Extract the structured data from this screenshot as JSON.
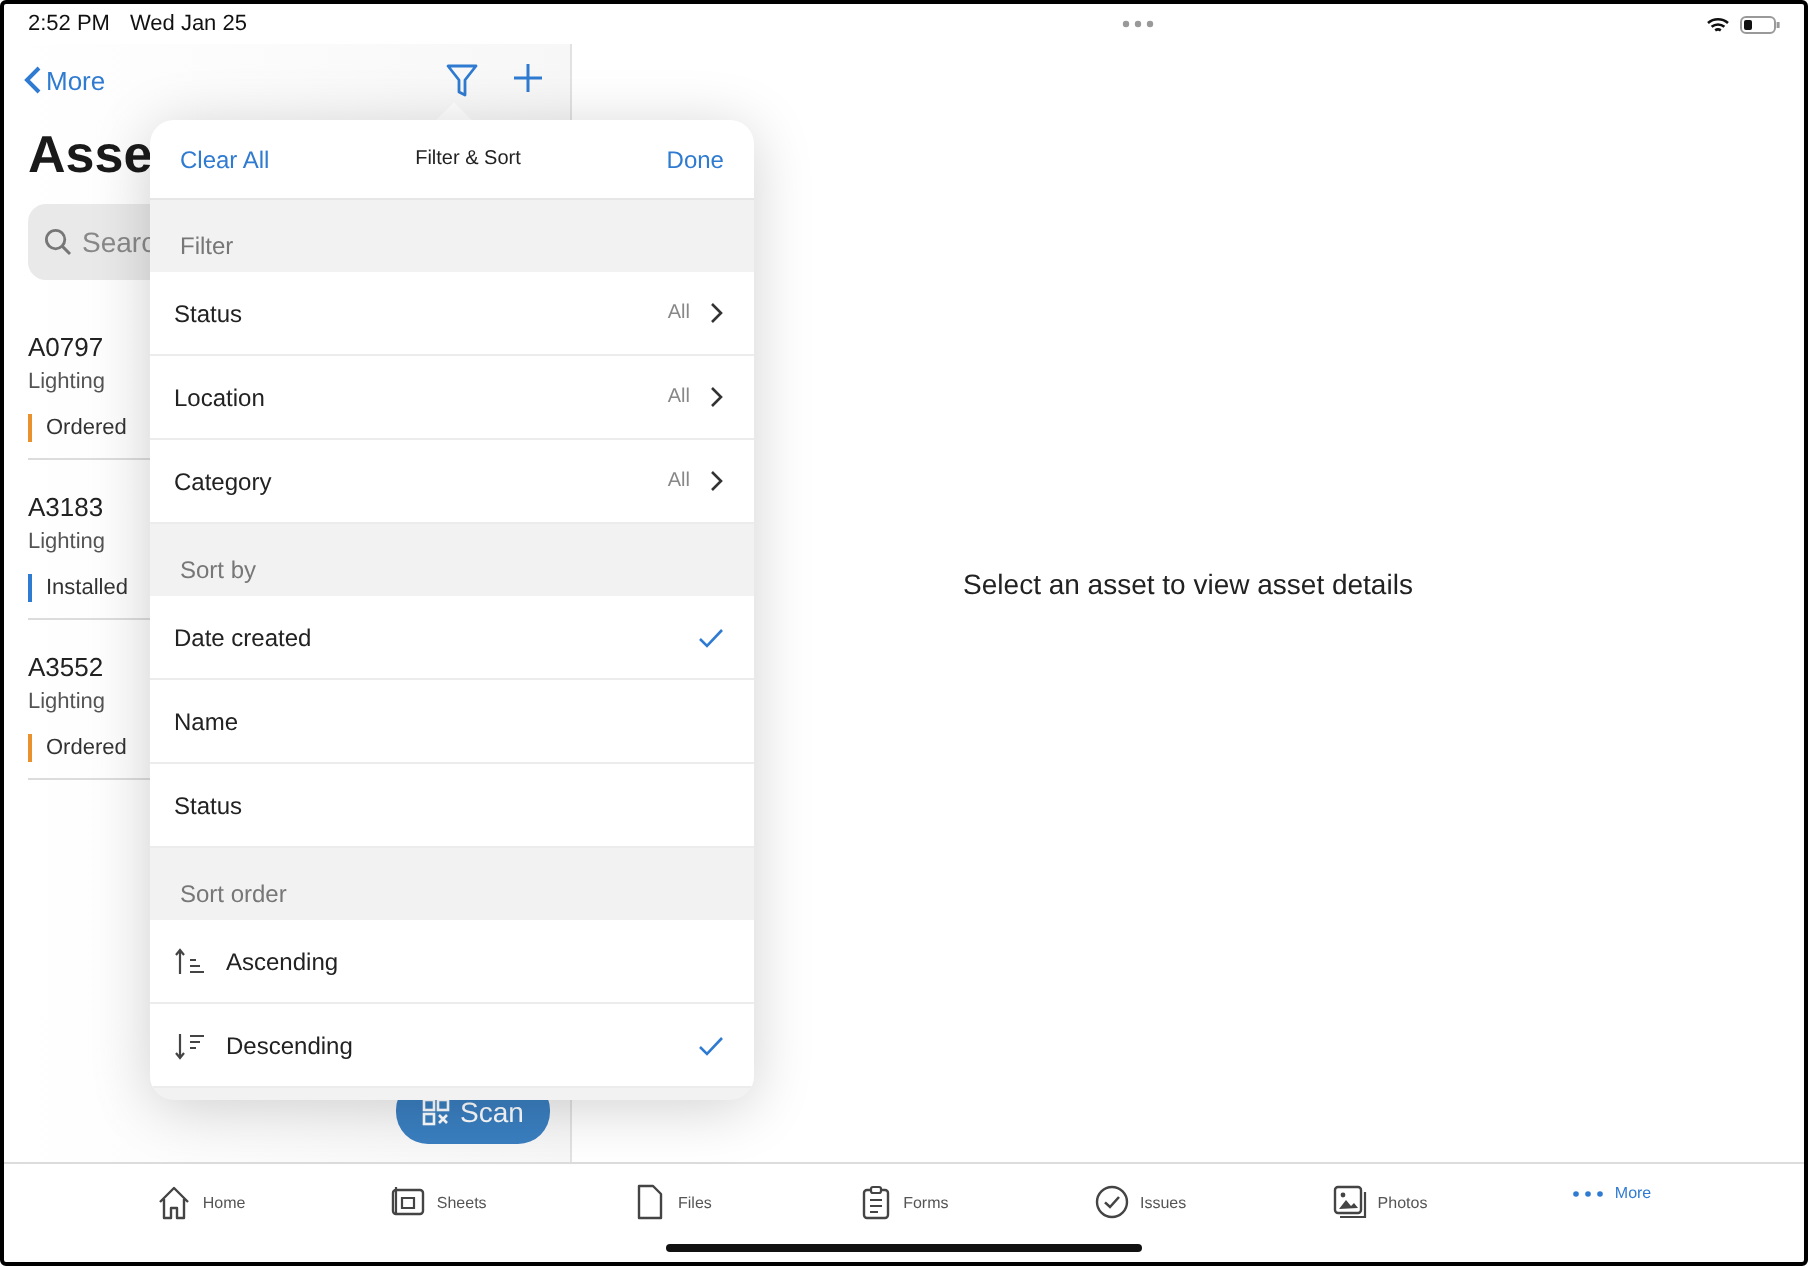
{
  "status_bar": {
    "time": "2:52 PM",
    "date": "Wed Jan 25"
  },
  "nav": {
    "back": "More",
    "title": "Asse"
  },
  "search": {
    "placeholder": "Searc"
  },
  "assets": [
    {
      "id": "A0797",
      "category": "Lighting",
      "status": "Ordered",
      "color": "#e8912d"
    },
    {
      "id": "A3183",
      "category": "Lighting",
      "status": "Installed",
      "color": "#2f7bd1"
    },
    {
      "id": "A3552",
      "category": "Lighting",
      "status": "Ordered",
      "color": "#e8912d"
    }
  ],
  "scan_button": "Scan",
  "detail_message": "Select an asset to view asset details",
  "popover": {
    "clear": "Clear All",
    "title": "Filter & Sort",
    "done": "Done",
    "sections": [
      {
        "title": "Filter",
        "items": [
          {
            "kind": "filter",
            "label": "Status",
            "value": "All"
          },
          {
            "kind": "filter",
            "label": "Location",
            "value": "All"
          },
          {
            "kind": "filter",
            "label": "Category",
            "value": "All"
          }
        ]
      },
      {
        "title": "Sort by",
        "items": [
          {
            "kind": "choice",
            "label": "Date created",
            "selected": true
          },
          {
            "kind": "choice",
            "label": "Name",
            "selected": false
          },
          {
            "kind": "choice",
            "label": "Status",
            "selected": false
          }
        ]
      },
      {
        "title": "Sort order",
        "items": [
          {
            "kind": "ascending",
            "label": "Ascending",
            "selected": false
          },
          {
            "kind": "descending",
            "label": "Descending",
            "selected": true
          }
        ]
      }
    ]
  },
  "tabs": [
    {
      "label": "Home",
      "selected": false
    },
    {
      "label": "Sheets",
      "selected": false
    },
    {
      "label": "Files",
      "selected": false
    },
    {
      "label": "Forms",
      "selected": false
    },
    {
      "label": "Issues",
      "selected": false
    },
    {
      "label": "Photos",
      "selected": false
    },
    {
      "label": "More",
      "selected": true
    }
  ]
}
